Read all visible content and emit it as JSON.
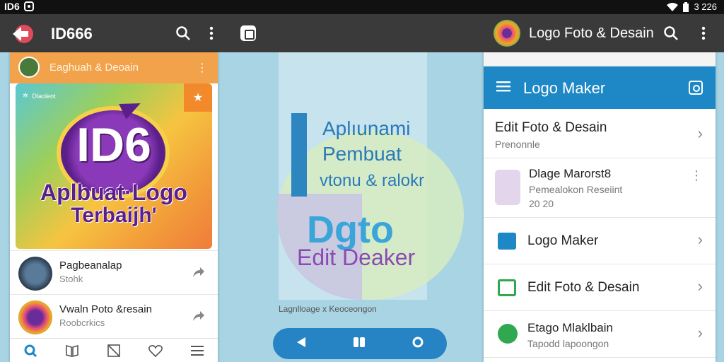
{
  "statusbar": {
    "left_label": "ID6",
    "right_label": "3 226"
  },
  "appbar": {
    "title_left": "ID666",
    "title_right": "Logo Foto & Desain"
  },
  "left_panel": {
    "header_title": "Eaghuah & Deoain",
    "banner": {
      "tag": "Dlaoleot",
      "big_text": "ID6",
      "line1": "Aplbuat·Logo",
      "line2": "Terbaijh'"
    },
    "rows": [
      {
        "title": "Pagbeanalap",
        "subtitle": "Stohk"
      },
      {
        "title": "Vwaln Poto &resain",
        "subtitle": "Roobcrkics"
      }
    ]
  },
  "center": {
    "line1": "Aplıunami",
    "line2": "Pembuat",
    "line3": "vtonu & ralokr",
    "big": "Dgto",
    "line5": "Edit Deaker",
    "footer": "Lagnlloage x Keoceongon"
  },
  "right_panel": {
    "header_title": "Logo Maker",
    "items": [
      {
        "title": "Edit Foto & Desain",
        "subtitle": "Prenonnle"
      },
      {
        "title": "Dlage Marorst8",
        "subtitle": "Pemealokon Reseiint",
        "meta": "20 20"
      },
      {
        "title": "Logo Maker"
      },
      {
        "title": "Edit Foto & Desain"
      },
      {
        "title": "Etago Mlaklbain",
        "subtitle": "Tapodd lapoongon"
      }
    ]
  },
  "colors": {
    "accent": "#1e88c7",
    "appbar": "#3a3a3a",
    "orange": "#f3a24c"
  }
}
